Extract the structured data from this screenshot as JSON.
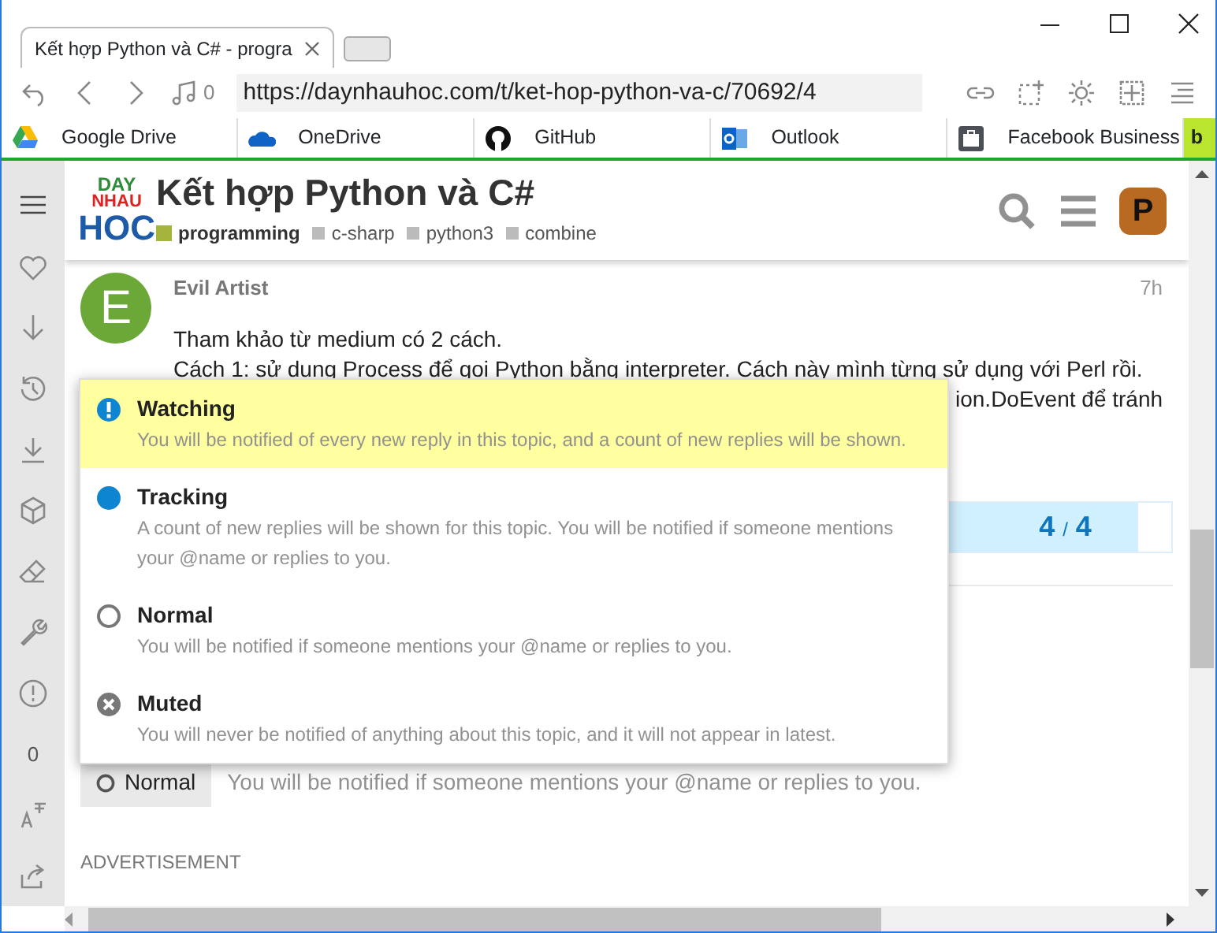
{
  "browser": {
    "tabs": [
      {
        "title": "Kết hợp Python và C# - progra",
        "selected": true
      }
    ],
    "media_count": "0",
    "url": "https://daynhauhoc.com/t/ket-hop-python-va-c/70692/4",
    "bookmarks": [
      {
        "kind": "drive",
        "label": "Google Drive"
      },
      {
        "kind": "onedrive",
        "label": "OneDrive"
      },
      {
        "kind": "github",
        "label": "GitHub"
      },
      {
        "kind": "outlook",
        "label": "Outlook"
      },
      {
        "kind": "briefcase",
        "label": "Facebook Business"
      },
      {
        "kind": "b",
        "label": "b"
      }
    ]
  },
  "sidebar": {
    "counter": "0"
  },
  "topic": {
    "logo": [
      "DAY",
      "NHAU",
      "HOC"
    ],
    "title": "Kết hợp Python và C#",
    "category": {
      "name": "programming",
      "color": "#a5b43c"
    },
    "tags": [
      "c-sharp",
      "python3",
      "combine"
    ],
    "avatar_letter": "P"
  },
  "post": {
    "author": "Evil Artist",
    "time": "7h",
    "avatar_letter": "E",
    "lines": [
      "Tham khảo từ medium có 2 cách.",
      "Cách 1: sử dụng Process để gọi Python bằng interpreter. Cách này mình từng sử dụng với Perl rồi."
    ],
    "partial_line": "ion.DoEvent để tránh"
  },
  "progress": {
    "current": "4",
    "separator": "/",
    "total": "4",
    "level": 0.95
  },
  "notification_menu": [
    {
      "kind": "watching",
      "label": "Watching",
      "description": "You will be notified of every new reply in this topic, and a count of new replies will be shown.",
      "selected": true
    },
    {
      "kind": "tracking",
      "label": "Tracking",
      "description": "A count of new replies will be shown for this topic. You will be notified if someone mentions your @name or replies to you.",
      "selected": false
    },
    {
      "kind": "normal",
      "label": "Normal",
      "description": "You will be notified if someone mentions your @name or replies to you.",
      "selected": false
    },
    {
      "kind": "muted",
      "label": "Muted",
      "description": "You will never be notified of anything about this topic, and it will not appear in latest.",
      "selected": false
    }
  ],
  "notification_button": {
    "label": "Normal",
    "description": "You will be notified if someone mentions your @name or replies to you."
  },
  "advertisement": "ADVERTISEMENT"
}
